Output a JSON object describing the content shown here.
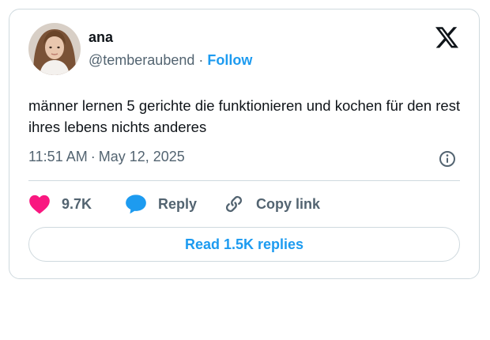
{
  "tweet": {
    "author": {
      "name": "ana",
      "handle": "@temberaubend",
      "separator": "·",
      "follow_label": "Follow"
    },
    "text": "männer lernen 5 gerichte die funktionieren und kochen für den rest ihres lebens nichts anderes",
    "time": "11:51 AM",
    "date_separator": "·",
    "date": "May 12, 2025",
    "actions": {
      "likes": "9.7K",
      "reply_label": "Reply",
      "copy_label": "Copy link"
    },
    "read_replies_label": "Read 1.5K replies"
  },
  "icons": {
    "brand": "x-logo-icon",
    "info": "info-icon",
    "like": "heart-icon",
    "reply": "speech-bubble-icon",
    "copy": "link-icon"
  },
  "colors": {
    "accent": "#1d9bf0",
    "like": "#f91880",
    "text": "#0f1419",
    "secondary_text": "#536471",
    "border": "#cfd9de"
  }
}
